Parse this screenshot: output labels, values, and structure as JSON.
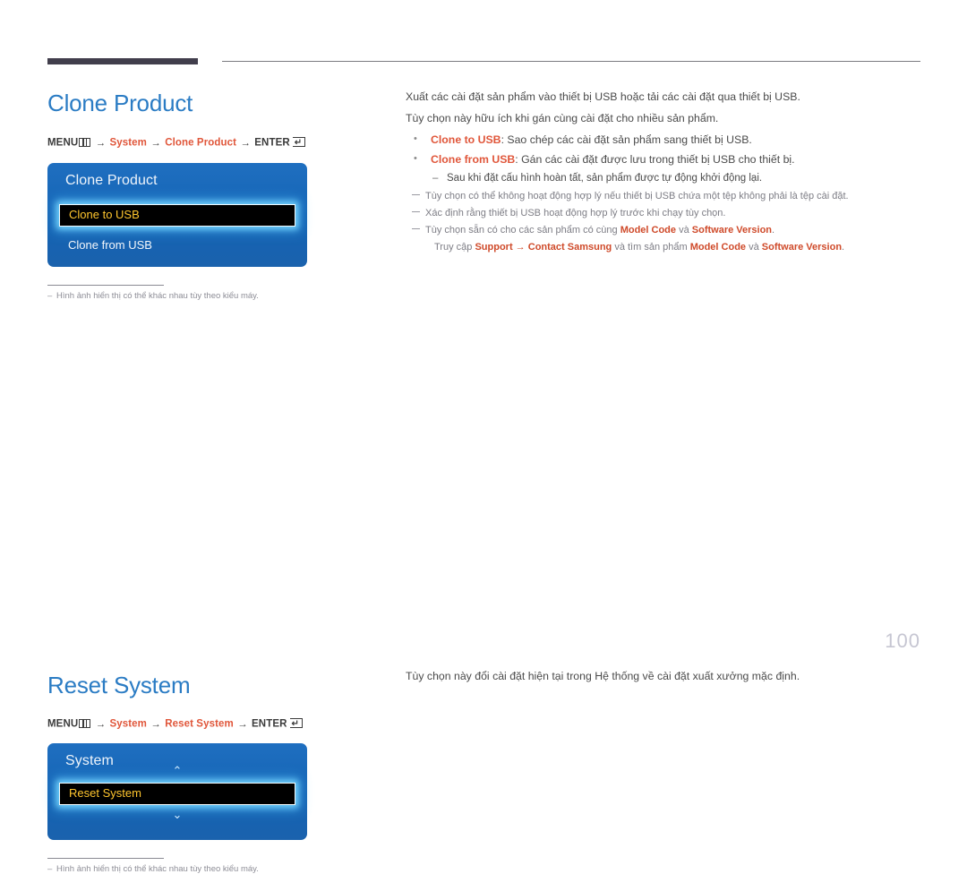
{
  "document": {
    "page_number": "100"
  },
  "sections": [
    {
      "id": "clone-product",
      "heading": "Clone Product",
      "menu_path": {
        "menu_label": "MENU",
        "menu_icon": "menu-grid-icon",
        "arrow": "→",
        "step1": "System",
        "step2": "Clone Product",
        "enter_label": "ENTER",
        "enter_icon": "enter-return-icon"
      },
      "osd": {
        "title": "Clone Product",
        "rows": [
          {
            "label": "Clone to USB",
            "selected": true
          },
          {
            "label": "Clone from USB",
            "selected": false
          }
        ],
        "chevron_up": "⌃",
        "chevron_down": "⌄"
      },
      "footnote": "Hình ảnh hiển thị có thể khác nhau tùy theo kiểu máy.",
      "body": {
        "paragraphs": [
          "Xuất các cài đặt sản phẩm vào thiết bị USB hoặc tải các cài đặt qua thiết bị USB.",
          "Tùy chọn này hữu ích khi gán cùng cài đặt cho nhiều sản phẩm."
        ],
        "bullets": [
          {
            "key": "Clone to USB",
            "text": ": Sao chép các cài đặt sản phẩm sang thiết bị USB."
          },
          {
            "key": "Clone from USB",
            "text": ": Gán các cài đặt được lưu trong thiết bị USB cho thiết bị."
          }
        ],
        "subnote": "Sau khi đặt cấu hình hoàn tất, sản phẩm được tự động khởi động lại.",
        "dashnotes": [
          {
            "text": "Tùy chọn có thể không hoạt động hợp lý nếu thiết bị USB chứa một tệp không phải là tệp cài đặt."
          },
          {
            "text": "Xác định rằng thiết bị USB hoạt động hợp lý trước khi chạy tùy chọn."
          }
        ],
        "model_note": {
          "line1_a": "Tùy chọn sẵn có cho các sản phẩm có cùng ",
          "line1_b": "Model Code",
          "line1_c": " và ",
          "line1_d": "Software Version",
          "line1_e": ".",
          "line2_a": "Truy cập ",
          "line2_b": "Support",
          "line2_arrow": " → ",
          "line2_c": "Contact Samsung",
          "line2_d": " và tìm sản phẩm ",
          "line2_e": "Model Code",
          "line2_f": " và ",
          "line2_g": "Software Version",
          "line2_h": "."
        }
      }
    },
    {
      "id": "reset-system",
      "heading": "Reset System",
      "menu_path": {
        "menu_label": "MENU",
        "menu_icon": "menu-grid-icon",
        "arrow": "→",
        "step1": "System",
        "step2": "Reset System",
        "enter_label": "ENTER",
        "enter_icon": "enter-return-icon"
      },
      "osd": {
        "title": "System",
        "rows": [
          {
            "label": "Reset System",
            "selected": true
          }
        ],
        "chevron_up": "⌃",
        "chevron_down": "⌄"
      },
      "footnote": "Hình ảnh hiển thị có thể khác nhau tùy theo kiểu máy.",
      "body": {
        "paragraphs": [
          "Tùy chọn này đổi cài đặt hiện tại trong Hệ thống về cài đặt xuất xưởng mặc định."
        ]
      }
    }
  ],
  "colors": {
    "heading_blue": "#2b7cc4",
    "accent_orange": "#e0563a",
    "osd_blue": "#1463b4",
    "osd_selected_text": "#ffc62e",
    "rule_dark": "#413e4c",
    "page_number": "#c6c6d2"
  }
}
